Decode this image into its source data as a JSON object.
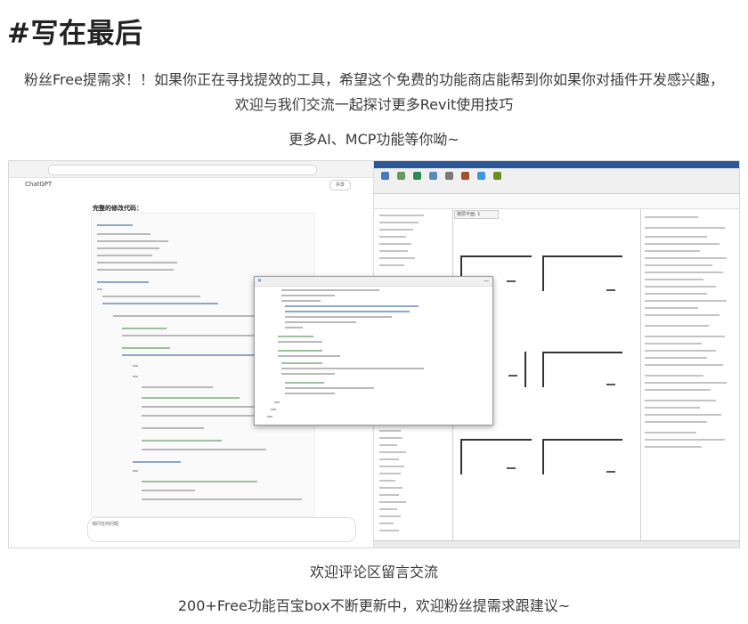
{
  "heading": "#写在最后",
  "paragraphs": {
    "line1": "粉丝Free提需求！！如果你正在寻找提效的工具，希望这个免费的功能商店能帮到你如果你对插件开发感兴趣，",
    "line2": "欢迎与我们交流一起探讨更多Revit使用技巧",
    "line3": "更多AI、MCP功能等你呦~",
    "line4": "欢迎评论区留言交流",
    "line5": "200+Free功能百宝box不断更新中，欢迎粉丝提需求跟建议~"
  },
  "screenshot": {
    "chat_app_title": "ChatGPT",
    "code_heading": "完整的修改代码：",
    "share_label": "共享",
    "input_hint": "询问任何问题",
    "dialog_close": "✕",
    "dialog_minimize": "—",
    "view_tab": "楼层平面: 1"
  },
  "icons": {
    "close": "close-icon",
    "minimize": "minimize-icon"
  }
}
